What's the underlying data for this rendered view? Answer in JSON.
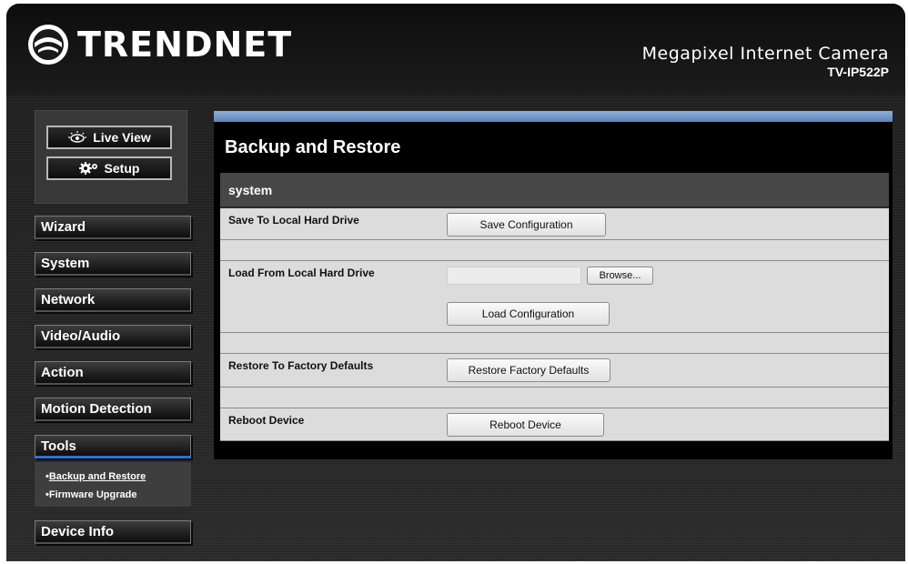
{
  "header": {
    "brand": "TRENDNET",
    "product_name": "Megapixel Internet Camera",
    "model": "TV-IP522P"
  },
  "sidebar": {
    "modes": [
      {
        "label": "Live View",
        "icon": "eye-icon"
      },
      {
        "label": "Setup",
        "icon": "gears-icon"
      }
    ],
    "menu": [
      {
        "label": "Wizard"
      },
      {
        "label": "System"
      },
      {
        "label": "Network"
      },
      {
        "label": "Video/Audio"
      },
      {
        "label": "Action"
      },
      {
        "label": "Motion Detection"
      },
      {
        "label": "Tools",
        "active": true
      },
      {
        "label": "Device Info"
      }
    ],
    "submenu": [
      {
        "bullet": "•",
        "label": "Backup and Restore",
        "current": true
      },
      {
        "bullet": "•",
        "label": "Firmware Upgrade"
      }
    ]
  },
  "main": {
    "title": "Backup and Restore",
    "section": "system",
    "rows": {
      "save": {
        "label": "Save To Local Hard Drive",
        "button": "Save Configuration"
      },
      "load": {
        "label": "Load From Local Hard Drive",
        "file_value": "",
        "browse": "Browse...",
        "button": "Load Configuration"
      },
      "restore": {
        "label": "Restore To Factory Defaults",
        "button": "Restore Factory Defaults"
      },
      "reboot": {
        "label": "Reboot Device",
        "button": "Reboot Device"
      }
    }
  },
  "colors": {
    "accent_bar": "#7a9fd0",
    "active_underline": "#2d6fd6",
    "background": "#222222"
  }
}
